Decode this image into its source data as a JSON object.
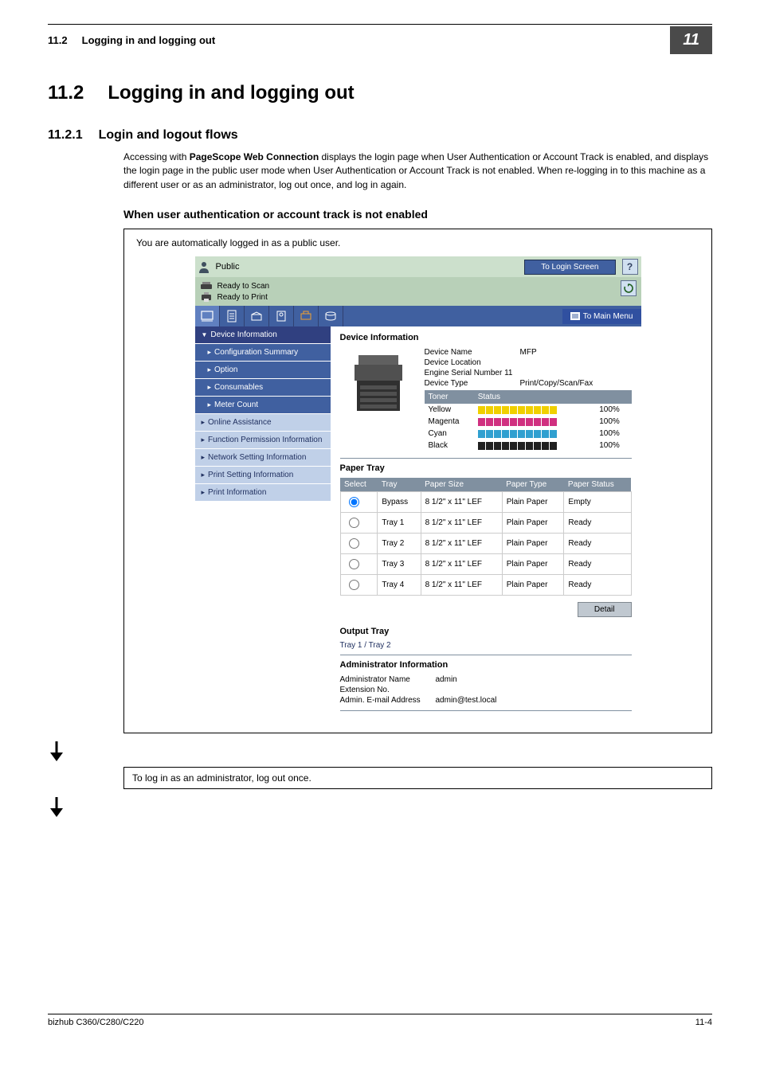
{
  "header": {
    "breadcrumb_section": "11.2",
    "breadcrumb_title": "Logging in and logging out",
    "chapter_badge": "11"
  },
  "section": {
    "number": "11.2",
    "title": "Logging in and logging out"
  },
  "subsection": {
    "number": "11.2.1",
    "title": "Login and logout flows",
    "body_prefix": "Accessing with ",
    "body_bold": "PageScope Web Connection",
    "body_suffix": " displays the login page when User Authentication or Account Track is enabled, and displays the login page in the public user mode when User Authentication or Account Track is not enabled. When re-logging in to this machine as a different user or as an administrator, log out once, and log in again."
  },
  "case_heading": "When user authentication or account track is not enabled",
  "box_intro": "You are automatically logged in as a public user.",
  "screenshot": {
    "user_label": "Public",
    "login_button": "To Login Screen",
    "status_scan": "Ready to Scan",
    "status_print": "Ready to Print",
    "main_menu": "To Main Menu",
    "nav": {
      "device_info": "Device Information",
      "config_summary": "Configuration Summary",
      "option": "Option",
      "consumables": "Consumables",
      "meter": "Meter Count",
      "online": "Online Assistance",
      "func_perm": "Function Permission Information",
      "net_setting": "Network Setting Information",
      "print_setting": "Print Setting Information",
      "print_info": "Print Information"
    },
    "content_title": "Device Information",
    "device": {
      "name_label": "Device Name",
      "name_value": "MFP",
      "loc_label": "Device Location",
      "serial_label": "Engine Serial Number 11",
      "type_label": "Device Type",
      "type_value": "Print/Copy/Scan/Fax"
    },
    "toner": {
      "head_toner": "Toner",
      "head_status": "Status",
      "rows": [
        {
          "name": "Yellow",
          "pct": "100%",
          "color": "#f0d000"
        },
        {
          "name": "Magenta",
          "pct": "100%",
          "color": "#d03080"
        },
        {
          "name": "Cyan",
          "pct": "100%",
          "color": "#30a0d0"
        },
        {
          "name": "Black",
          "pct": "100%",
          "color": "#202020"
        }
      ]
    },
    "paper_tray_heading": "Paper Tray",
    "paper": {
      "head_select": "Select",
      "head_tray": "Tray",
      "head_size": "Paper Size",
      "head_type": "Paper Type",
      "head_status": "Paper Status",
      "rows": [
        {
          "tray": "Bypass",
          "size": "8 1/2\" x 11\" LEF",
          "type": "Plain Paper",
          "status": "Empty"
        },
        {
          "tray": "Tray 1",
          "size": "8 1/2\" x 11\" LEF",
          "type": "Plain Paper",
          "status": "Ready"
        },
        {
          "tray": "Tray 2",
          "size": "8 1/2\" x 11\" LEF",
          "type": "Plain Paper",
          "status": "Ready"
        },
        {
          "tray": "Tray 3",
          "size": "8 1/2\" x 11\" LEF",
          "type": "Plain Paper",
          "status": "Ready"
        },
        {
          "tray": "Tray 4",
          "size": "8 1/2\" x 11\" LEF",
          "type": "Plain Paper",
          "status": "Ready"
        }
      ]
    },
    "detail_button": "Detail",
    "output_tray_heading": "Output Tray",
    "output_tray_value": "Tray 1 / Tray 2",
    "admin_heading": "Administrator Information",
    "admin": {
      "name_label": "Administrator Name",
      "name_value": "admin",
      "ext_label": "Extension No.",
      "email_label": "Admin. E-mail Address",
      "email_value": "admin@test.local"
    }
  },
  "step2_box": "To log in as an administrator, log out once.",
  "footer": {
    "left": "bizhub C360/C280/C220",
    "right": "11-4"
  }
}
